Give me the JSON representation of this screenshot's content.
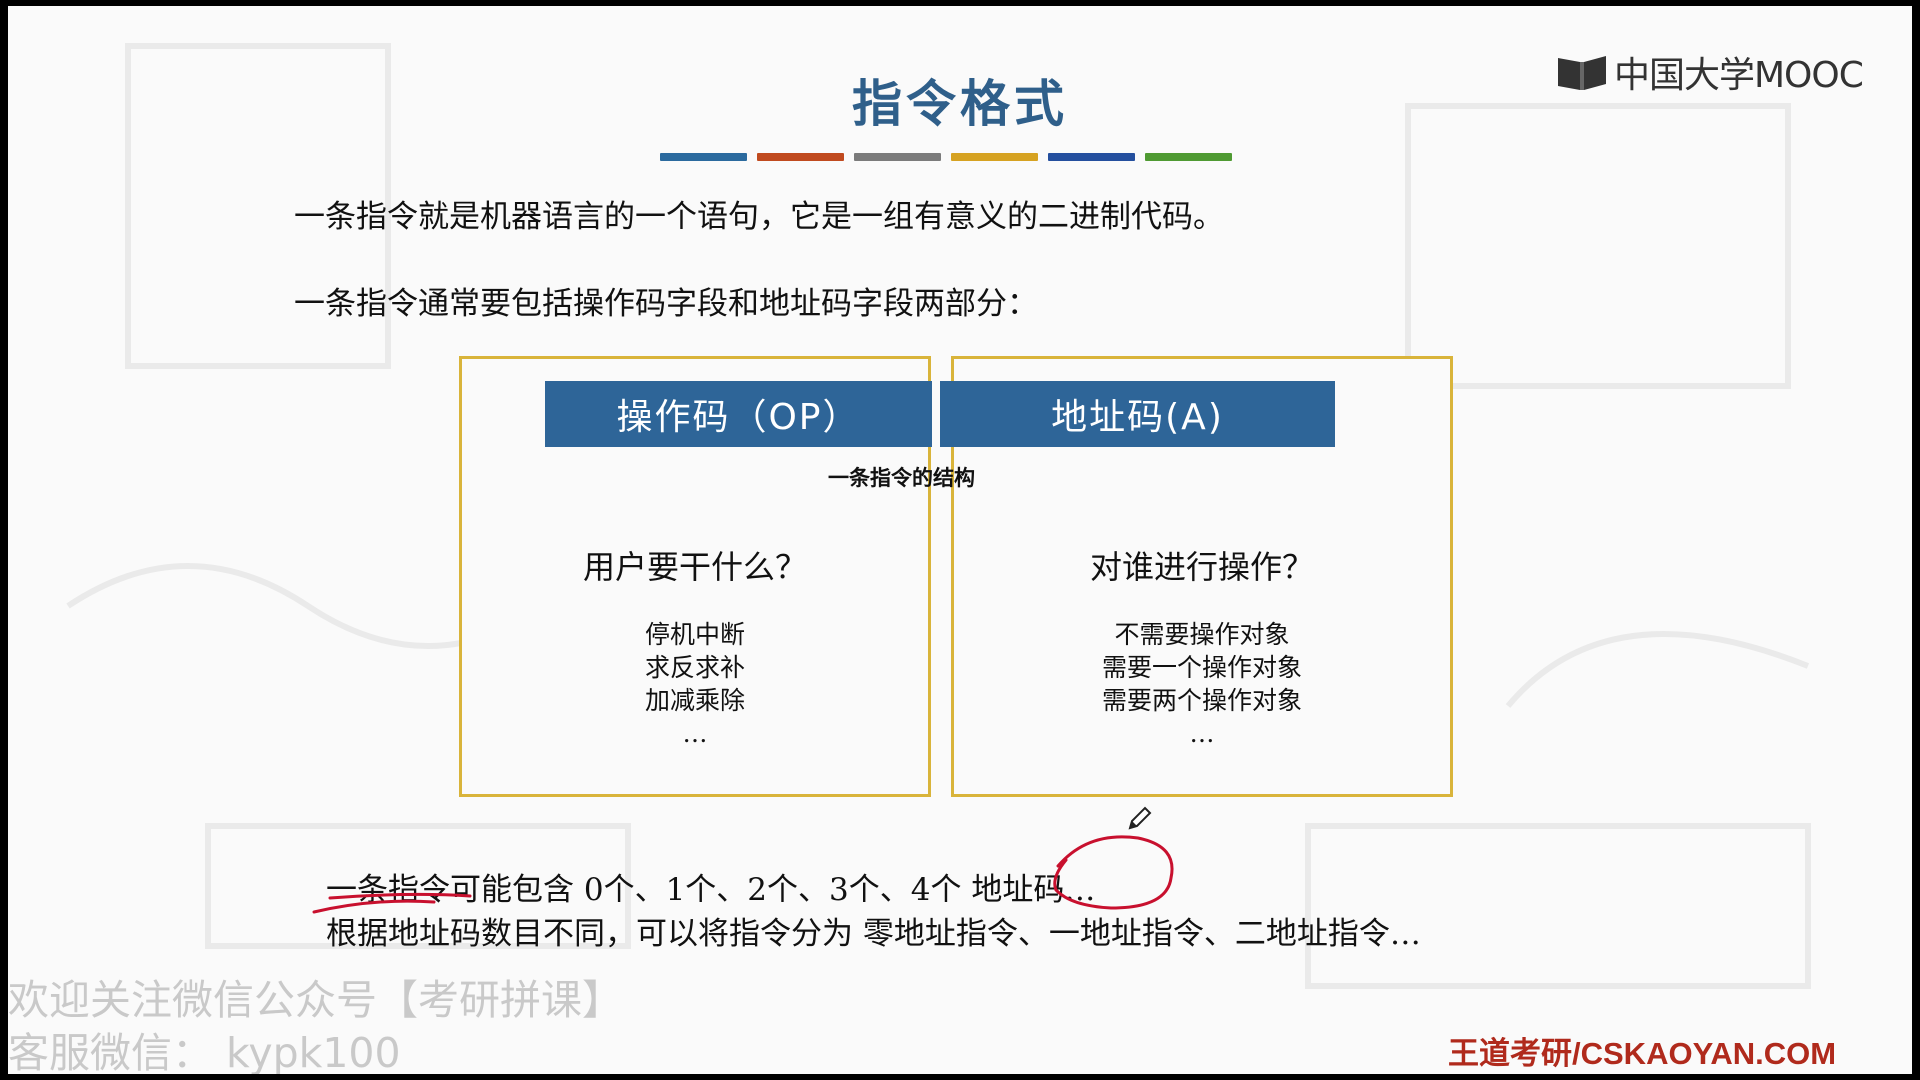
{
  "slide": {
    "title": "指令格式",
    "bar_colors": [
      "#2b6a9e",
      "#c04a1f",
      "#7b7b7b",
      "#d6a221",
      "#244f9e",
      "#4f9a32"
    ],
    "logo_text": "中国大学MOOC",
    "line1": "一条指令就是机器语言的一个语句，它是一组有意义的二进制代码。",
    "line2": "一条指令通常要包括操作码字段和地址码字段两部分："
  },
  "structure": {
    "op_header": "操作码（OP）",
    "addr_header": "地址码(A)",
    "caption": "一条指令的结构",
    "left_question": "用户要干什么？",
    "left_items": [
      "停机中断",
      "求反求补",
      "加减乘除",
      "…"
    ],
    "right_question": "对谁进行操作？",
    "right_items": [
      "不需要操作对象",
      "需要一个操作对象",
      "需要两个操作对象",
      "…"
    ]
  },
  "bottom": {
    "line1": "一条指令可能包含 0个、1个、2个、3个、4个 地址码…",
    "line2": "根据地址码数目不同，可以将指令分为 零地址指令、一地址指令、二地址指令…"
  },
  "watermark": {
    "line1": "欢迎关注微信公众号【考研拼课】",
    "line2": "客服微信：  kypk100"
  },
  "footer": {
    "brand": "王道考研/CSKAOYAN.COM"
  },
  "icons": {
    "logo": "mooc-book-icon",
    "cursor": "pencil-icon"
  },
  "colors": {
    "header_bg": "#2e6598",
    "box_border": "#d9b43a",
    "title": "#2f5f8a",
    "annotation": "#c8102e",
    "brand": "#b02a1c"
  }
}
